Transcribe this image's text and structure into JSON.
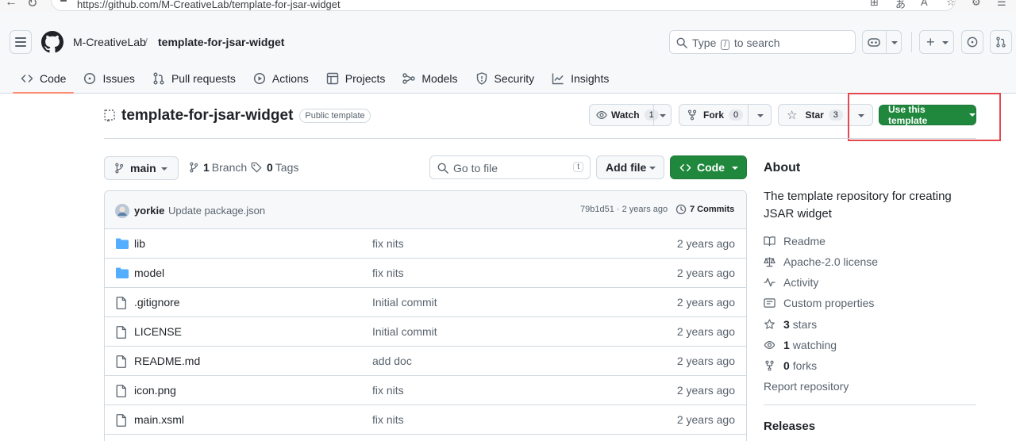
{
  "browser": {
    "url": "https://github.com/M-CreativeLab/template-for-jsar-widget"
  },
  "header": {
    "owner": "M-CreativeLab",
    "separator": "/",
    "repo": "template-for-jsar-widget",
    "search_prefix": "Type",
    "search_key": "/",
    "search_suffix": "to search"
  },
  "tabs": [
    {
      "label": "Code",
      "icon": "code-icon",
      "active": true
    },
    {
      "label": "Issues",
      "icon": "issue-opened-icon"
    },
    {
      "label": "Pull requests",
      "icon": "git-pull-request-icon"
    },
    {
      "label": "Actions",
      "icon": "play-icon"
    },
    {
      "label": "Projects",
      "icon": "table-icon"
    },
    {
      "label": "Models",
      "icon": "models-icon"
    },
    {
      "label": "Security",
      "icon": "shield-icon"
    },
    {
      "label": "Insights",
      "icon": "graph-icon"
    }
  ],
  "repo": {
    "name": "template-for-jsar-widget",
    "visibility": "Public template",
    "watch_label": "Watch",
    "watch_count": "1",
    "fork_label": "Fork",
    "fork_count": "0",
    "star_label": "Star",
    "star_count": "3",
    "use_template_label": "Use this template"
  },
  "filenav": {
    "branch": "main",
    "branches_count": "1",
    "branches_label": "Branch",
    "tags_count": "0",
    "tags_label": "Tags",
    "goto_placeholder": "Go to file",
    "goto_key": "t",
    "add_file_label": "Add file",
    "code_label": "Code"
  },
  "latest_commit": {
    "author": "yorkie",
    "message": "Update package.json",
    "sha": "79b1d51",
    "dot": "·",
    "age": "2 years ago",
    "commits_label": "7 Commits"
  },
  "files": [
    {
      "name": "lib",
      "type": "folder",
      "message": "fix nits",
      "date": "2 years ago"
    },
    {
      "name": "model",
      "type": "folder",
      "message": "fix nits",
      "date": "2 years ago"
    },
    {
      "name": ".gitignore",
      "type": "file",
      "message": "Initial commit",
      "date": "2 years ago"
    },
    {
      "name": "LICENSE",
      "type": "file",
      "message": "Initial commit",
      "date": "2 years ago"
    },
    {
      "name": "README.md",
      "type": "file",
      "message": "add doc",
      "date": "2 years ago"
    },
    {
      "name": "icon.png",
      "type": "file",
      "message": "fix nits",
      "date": "2 years ago"
    },
    {
      "name": "main.xsml",
      "type": "file",
      "message": "fix nits",
      "date": "2 years ago"
    }
  ],
  "about": {
    "heading": "About",
    "description": "The template repository for creating JSAR widget",
    "readme": "Readme",
    "license": "Apache-2.0 license",
    "activity": "Activity",
    "custom_properties": "Custom properties",
    "stars_count": "3",
    "stars_label": "stars",
    "watching_count": "1",
    "watching_label": "watching",
    "forks_count": "0",
    "forks_label": "forks",
    "report": "Report repository",
    "releases_heading": "Releases"
  },
  "colors": {
    "accent_green": "#1f883d",
    "tab_underline": "#fd8c73",
    "highlight_box": "#e5484d",
    "folder_blue": "#54aeff"
  }
}
